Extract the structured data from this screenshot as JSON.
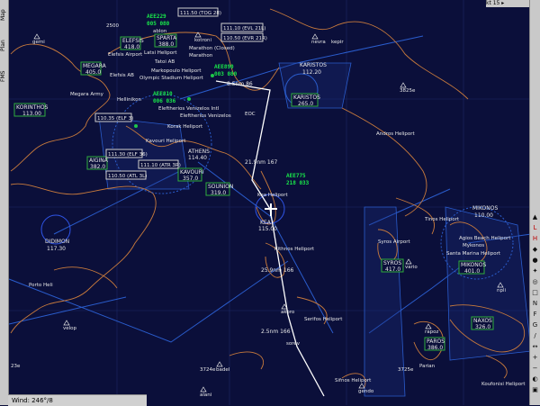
{
  "left_tabs": [
    "Map",
    "Plan",
    "FMS"
  ],
  "top_right": "kt 15 ▸",
  "status": {
    "wind": "Wind: 246°/8"
  },
  "route_labels": [
    "21.9nm 167",
    "25.9nm 166",
    "2.5nm 166",
    "8.5nm 86"
  ],
  "traffic": [
    {
      "callsign": "AEE775",
      "alt": "218 033"
    },
    {
      "callsign": "AEE229",
      "alt": "005 080"
    },
    {
      "callsign": "AEE890",
      "alt": "003 080"
    },
    {
      "callsign": "AEE810",
      "alt": "006 036"
    }
  ],
  "frequencies": [
    {
      "name": "ELEFSIS",
      "freq": "418.0"
    },
    {
      "name": "MEGARA",
      "freq": "405.0"
    },
    {
      "name": "KORINTHOS",
      "freq": "113.00"
    },
    {
      "name": "AIGINA",
      "freq": "382.0"
    },
    {
      "name": "KAVOURI",
      "freq": "357.0"
    },
    {
      "name": "SOUNION",
      "freq": "319.0"
    },
    {
      "name": "ATHENS",
      "freq": "114.40"
    },
    {
      "name": "KARISTOS",
      "freq": "112.20"
    },
    {
      "name": "KARISTOS",
      "freq": "265.0"
    },
    {
      "name": "KEA",
      "freq": "115.00"
    },
    {
      "name": "DIDIMON",
      "freq": "117.30"
    },
    {
      "name": "SYROS",
      "freq": "417.0"
    },
    {
      "name": "MIKONOS",
      "freq": "110.00"
    },
    {
      "name": "MIKONOS",
      "freq": "401.0"
    },
    {
      "name": "NAXOS",
      "freq": "326.0"
    },
    {
      "name": "PAROS",
      "freq": "386.0"
    },
    {
      "name": "SPARTA",
      "freq": "388.0"
    }
  ],
  "ils_boxes": [
    "111.50 (TOG 28)",
    "111.10 (EVL 21L)",
    "110.50 (EVR 21R)",
    "111.30 (ELF 36)",
    "111.10 (ATR 3R)",
    "110.50 (ATL 3L)",
    "110.35 (ELF 3)"
  ],
  "place_labels": [
    "Elefsis Airport",
    "Latsi Heliport",
    "Tatoi AB",
    "Marathon (Closed)",
    "Marathon",
    "Markopoulo Heliport",
    "Olympic Stadium Heliport",
    "Elefsis AB",
    "Megara Army",
    "Hellinikon",
    "Korak Heliport",
    "Kavouri Heliport",
    "Eleftherios Venizelos Intl",
    "Eleftherios Venizelos",
    "Andros Heliport",
    "Kea Heliport",
    "Kithnos Heliport",
    "Tinos Heliport",
    "Syros Airport",
    "Agios Beach Heliport",
    "Mykonos",
    "Santa Marina Heliport",
    "Serifos Heliport",
    "Sifnos Heliport",
    "Koufonisi Heliport",
    "Porto Heli",
    "Parian"
  ],
  "waypoints": [
    "gemi",
    "velop",
    "nevra",
    "kepir",
    "ablon",
    "kotroni",
    "vario",
    "akoro",
    "sorev",
    "badel",
    "alani",
    "gendo",
    "rapoz",
    "npli",
    "3825e",
    "3724e",
    "3725e",
    "23e",
    "EOC",
    "2500"
  ],
  "map_colors": {
    "bg": "#0b0f3a",
    "coast": "#c87a3c",
    "airway": "#2a5ccc",
    "route": "#ffffff",
    "nav": "#3b6bff",
    "text": "#e8e8e8",
    "traffic": "#19e84a",
    "box": "#2fae3d"
  }
}
